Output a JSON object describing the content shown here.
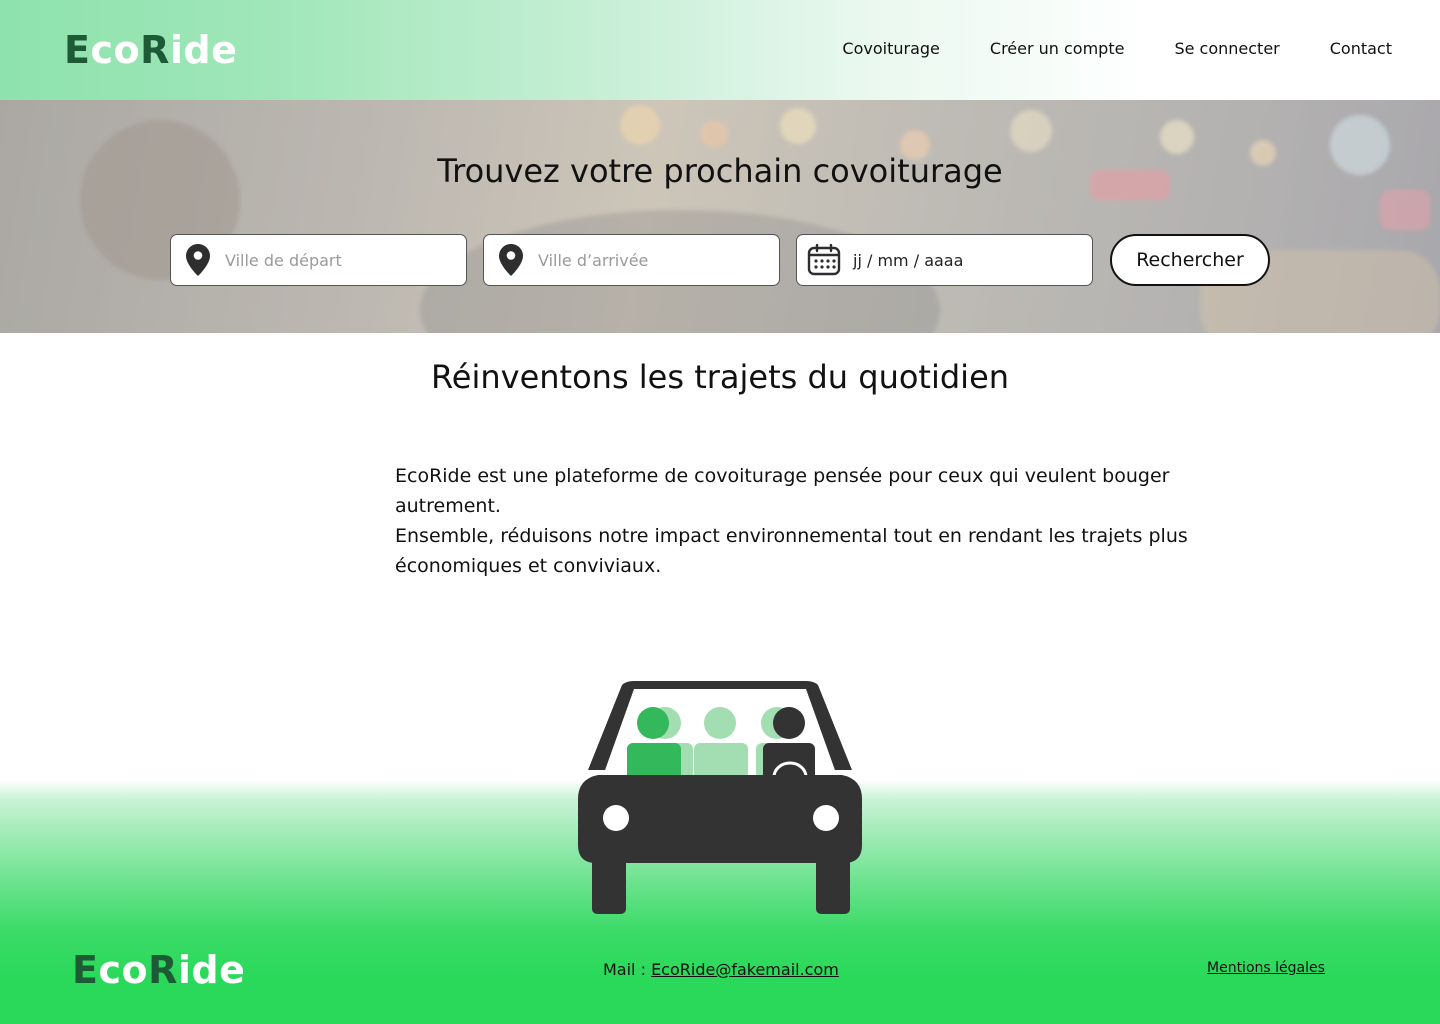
{
  "brand": {
    "part1": "E",
    "part2": "co",
    "part3": "R",
    "part4": "ide"
  },
  "nav": {
    "items": [
      "Covoiturage",
      "Créer un compte",
      "Se connecter",
      "Contact"
    ]
  },
  "hero": {
    "title": "Trouvez votre prochain covoiturage",
    "departure_placeholder": "Ville de départ",
    "arrival_placeholder": "Ville d’arrivée",
    "date_placeholder": "jj / mm / aaaa",
    "search_label": "Rechercher"
  },
  "intro": {
    "title": "Réinventons les trajets du quotidien",
    "paragraph1": "EcoRide est une plateforme de covoiturage pensée pour ceux qui veulent bouger autrement.",
    "paragraph2": "Ensemble, réduisons notre impact environnemental tout en rendant les trajets plus économiques et conviviaux."
  },
  "footer": {
    "mail_label": "Mail : ",
    "mail_value": "EcoRide@fakemail.com",
    "legal_label": "Mentions légales"
  },
  "icons": {
    "location": "map-pin-icon",
    "calendar": "calendar-icon",
    "illustration": "carpool-car-illustration"
  },
  "colors": {
    "brand_dark": "#1d5a36",
    "brand_green": "#2bd95a",
    "passenger_green": "#34b85c",
    "passenger_light": "#a3deb2",
    "car_dark": "#333333"
  }
}
